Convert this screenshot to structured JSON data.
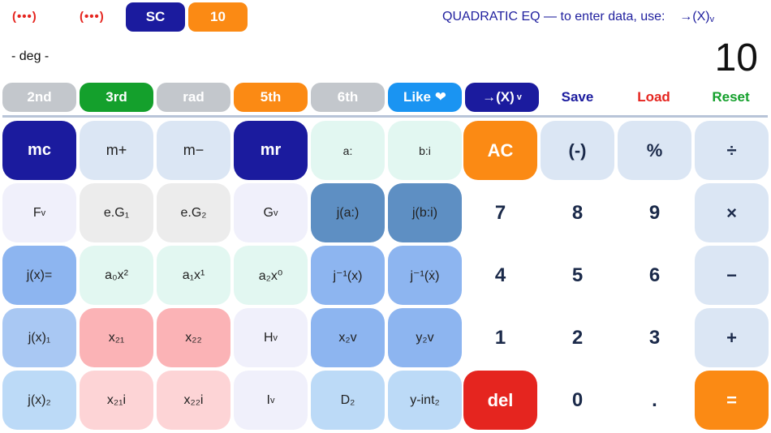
{
  "top_bar": {
    "dots_1": "(•••)",
    "dots_2": "(•••)",
    "sc_label": "SC",
    "value_label": "10",
    "hint": "QUADRATIC EQ — to enter data, use:",
    "hint_arrow": "→(X)",
    "hint_arrow_sub": "v"
  },
  "display": {
    "angle_mode": "- deg -",
    "value": "10"
  },
  "mode_row": {
    "items": [
      "2nd",
      "3rd",
      "rad",
      "5th",
      "6th",
      "Like ❤",
      "→(X)"
    ],
    "arrow_sub": "v",
    "save": "Save",
    "load": "Load",
    "reset": "Reset"
  },
  "keypad": {
    "row1": [
      "mc",
      "m+",
      "m−",
      "mr",
      "a:",
      "b:i",
      "AC",
      "(-)",
      "%",
      "÷"
    ],
    "row2": [
      "F",
      "e.G₁",
      "e.G₂",
      "G",
      "j(a:)",
      "j(b:i)",
      "7",
      "8",
      "9",
      "×"
    ],
    "row2_sub": "v",
    "row3": [
      "j(x)=",
      "a₀x²",
      "a₁x¹",
      "a₂x⁰",
      "j⁻¹(x)",
      "j⁻¹(ẋ)",
      "4",
      "5",
      "6",
      "−"
    ],
    "row4": [
      "j(x)₁",
      "x₂₁",
      "x₂₂",
      "H",
      "x₂v",
      "y₂v",
      "1",
      "2",
      "3",
      "+"
    ],
    "row4_sub": "v",
    "row5": [
      "j(x)₂",
      "x₂₁i",
      "x₂₂i",
      "I",
      "D₂",
      "y-int₂",
      "del",
      "0",
      ".",
      "="
    ],
    "row5_sub": "v"
  },
  "colors": {
    "navy": "#1b1b9e",
    "orange": "#fb8a14",
    "red": "#e5251f",
    "green": "#14a02c",
    "gray": "#c3c7cc",
    "light_blue": "#dbe6f4",
    "mint": "#e2f7f1",
    "steel": "#5e8fc3",
    "medium_blue": "#8db5f0",
    "pink": "#fbb3b6",
    "light_pink": "#fdd4d6",
    "lavender": "#f0f0fb",
    "pale_gray": "#ececec"
  }
}
